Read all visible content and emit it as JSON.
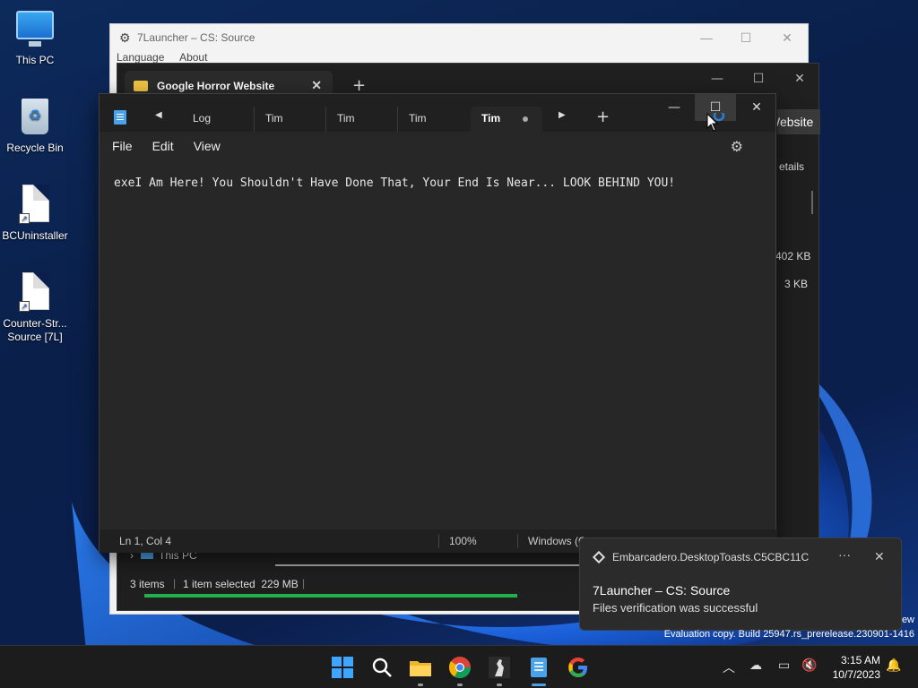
{
  "desktop": {
    "icons": [
      {
        "label": "This PC"
      },
      {
        "label": "Recycle Bin"
      },
      {
        "label": "BCUninstaller"
      },
      {
        "label_line1": "Counter-Str...",
        "label_line2": "Source [7L]"
      }
    ]
  },
  "launcher": {
    "title": "7Launcher – CS: Source",
    "menu": [
      "Language",
      "About"
    ]
  },
  "explorer": {
    "tab_label": "Google Horror Website",
    "side_button": "Website",
    "details_label": "etails",
    "size_1": "402 KB",
    "size_2": "3 KB",
    "nav_this_pc": "This PC",
    "status_items": "3 items",
    "status_selected": "1 item selected  229 MB"
  },
  "notepad": {
    "tabs": [
      "Log",
      "Tim",
      "Tim",
      "Tim",
      "Tim"
    ],
    "menu": [
      "File",
      "Edit",
      "View"
    ],
    "content": "exeI Am Here! You Shouldn't Have Done That, Your End Is Near... LOOK BEHIND YOU!",
    "status": {
      "position": "Ln 1, Col 4",
      "zoom": "100%",
      "line_ending": "Windows (C"
    }
  },
  "toast": {
    "app": "Embarcadero.DesktopToasts.C5CBC11C",
    "title": "7Launcher – CS: Source",
    "body": "Files verification was successful"
  },
  "watermark": {
    "line1": "ew",
    "line2": "Evaluation copy. Build 25947.rs_prerelease.230901-1416"
  },
  "taskbar": {
    "time": "3:15 AM",
    "date": "10/7/2023",
    "apps": [
      "start",
      "search",
      "file-explorer",
      "chrome",
      "counter-strike",
      "notepad",
      "google"
    ]
  },
  "colors": {
    "accent": "#4aa3e8",
    "progress": "#21b04a"
  }
}
